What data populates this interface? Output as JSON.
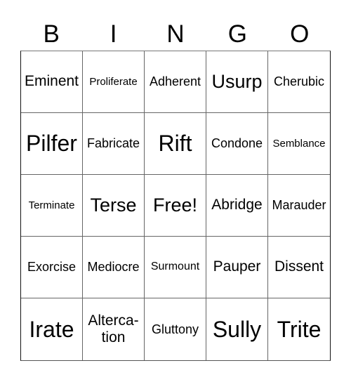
{
  "header": {
    "letters": [
      "B",
      "I",
      "N",
      "G",
      "O"
    ]
  },
  "card": {
    "rows": [
      [
        "Eminent",
        "Proliferate",
        "Adherent",
        "Usurp",
        "Cherubic"
      ],
      [
        "Pilfer",
        "Fabricate",
        "Rift",
        "Condone",
        "Semblance"
      ],
      [
        "Terminate",
        "Terse",
        "Free!",
        "Abridge",
        "Marauder"
      ],
      [
        "Exorcise",
        "Mediocre",
        "Surmount",
        "Pauper",
        "Dissent"
      ],
      [
        "Irate",
        "Alterca-\ntion",
        "Gluttony",
        "Sully",
        "Trite"
      ]
    ],
    "free_space": "Free!"
  }
}
